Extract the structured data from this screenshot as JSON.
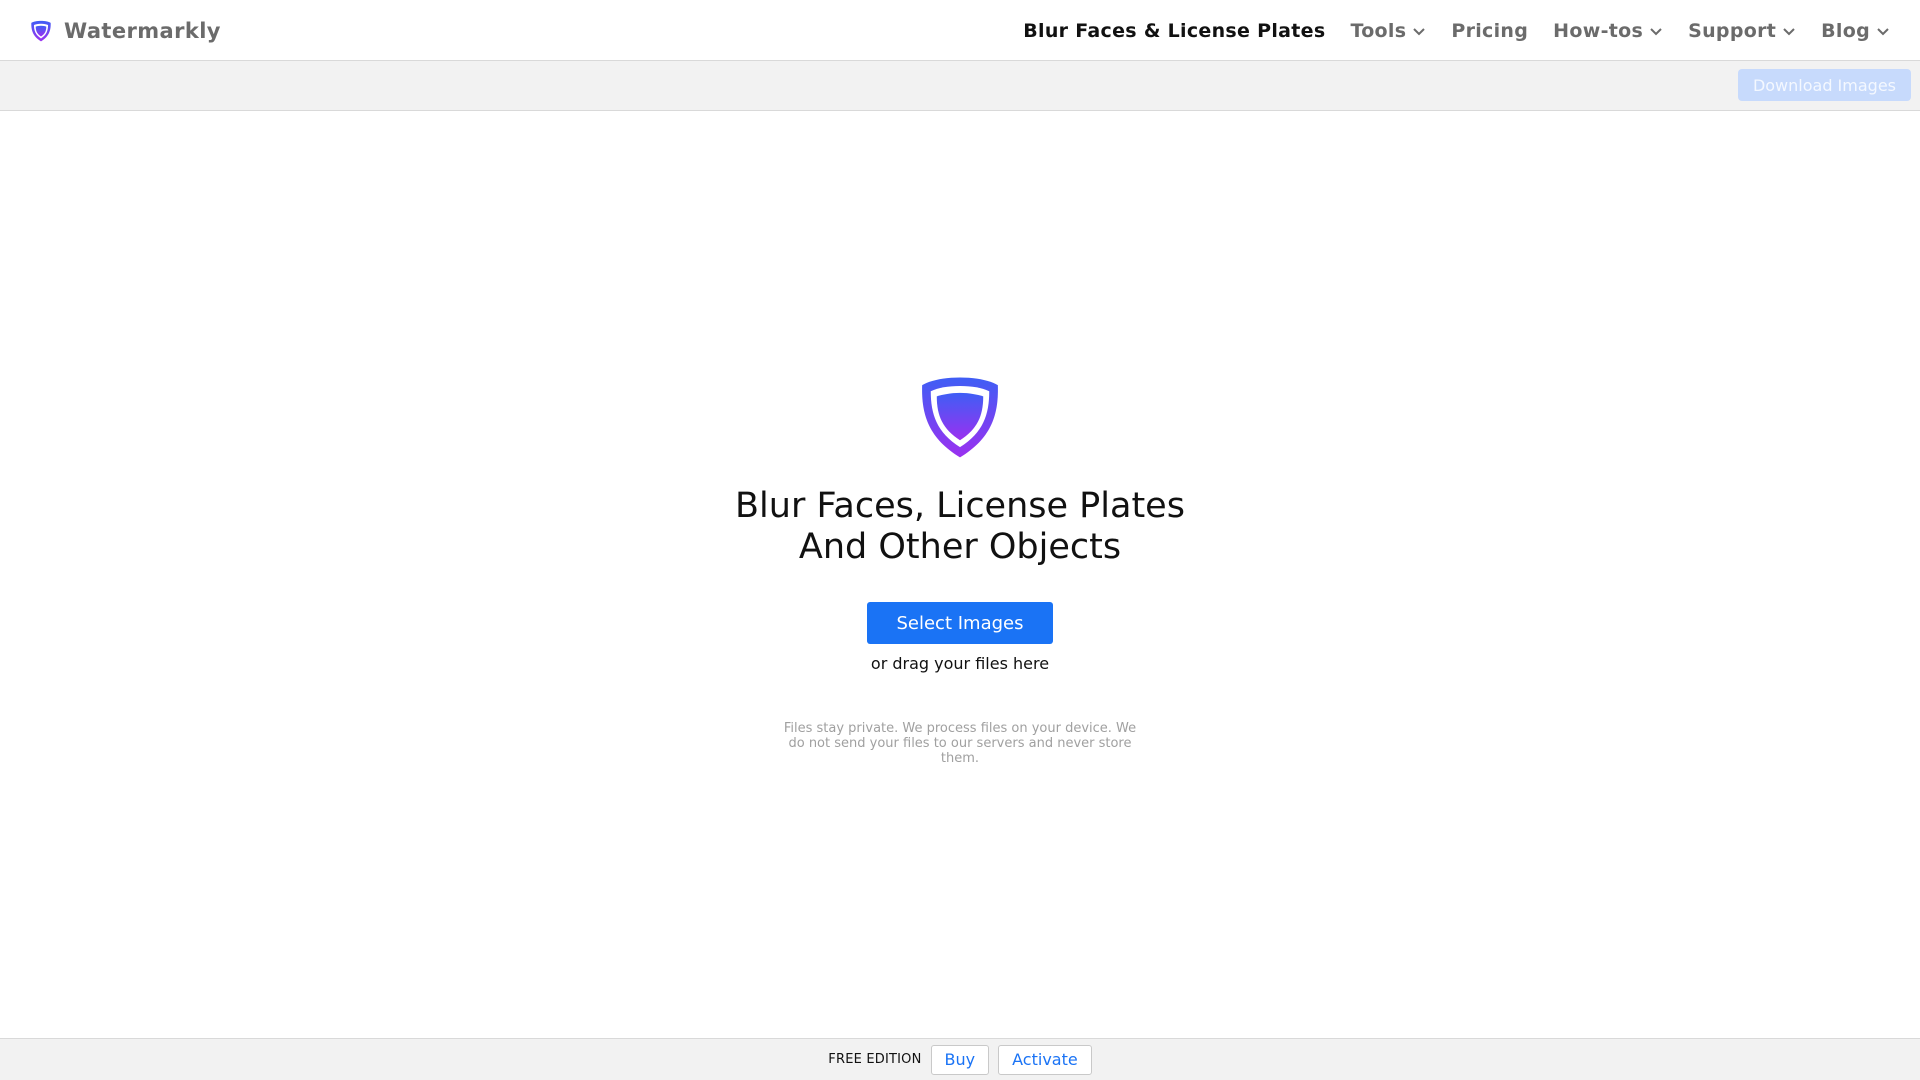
{
  "brand": {
    "name": "Watermarkly",
    "logo_icon": "shield-icon"
  },
  "nav": {
    "items": [
      {
        "label": "Blur Faces & License Plates",
        "dropdown": false,
        "active": true
      },
      {
        "label": "Tools",
        "dropdown": true,
        "active": false
      },
      {
        "label": "Pricing",
        "dropdown": false,
        "active": false
      },
      {
        "label": "How-tos",
        "dropdown": true,
        "active": false
      },
      {
        "label": "Support",
        "dropdown": true,
        "active": false
      },
      {
        "label": "Blog",
        "dropdown": true,
        "active": false
      }
    ]
  },
  "toolbar": {
    "download_label": "Download Images"
  },
  "hero": {
    "icon": "shield-icon",
    "title_line1": "Blur Faces, License Plates",
    "title_line2": "And Other Objects",
    "select_label": "Select Images",
    "drag_text": "or drag your files here",
    "privacy_text": "Files stay private. We process files on your device. We do not send your files to our servers and never store them."
  },
  "footer": {
    "edition_label": "FREE EDITION",
    "buy_label": "Buy",
    "activate_label": "Activate"
  },
  "colors": {
    "accent": "#1a73f5",
    "disabled_button": "#c7dafc",
    "shield_gradient_top": "#3f5ef5",
    "shield_gradient_bottom": "#9b30f0",
    "muted_text": "#a0a0a0",
    "nav_text": "#6b6b6b"
  }
}
